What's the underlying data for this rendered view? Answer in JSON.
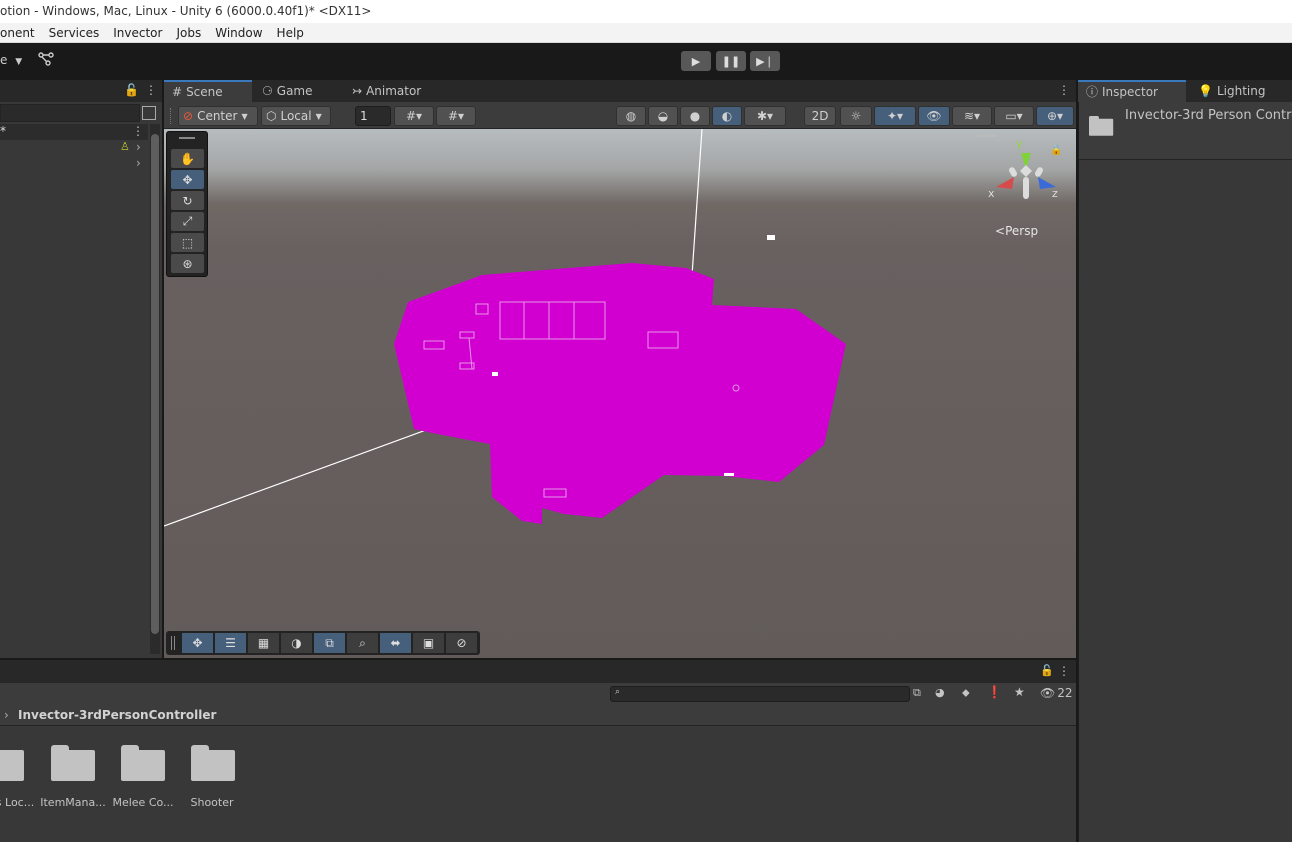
{
  "window": {
    "title": "otion - Windows, Mac, Linux - Unity 6 (6000.0.40f1)* <DX11>"
  },
  "menu": [
    "onent",
    "Services",
    "Invector",
    "Jobs",
    "Window",
    "Help"
  ],
  "toolbar": {
    "layout_fragment": "e",
    "play_icon": "play-icon",
    "pause_icon": "pause-icon",
    "step_icon": "step-icon"
  },
  "hierarchy": {
    "star": "*"
  },
  "scene_tabs": [
    {
      "label": "Scene",
      "icon": "#",
      "active": true
    },
    {
      "label": "Game",
      "icon": "gamepad-icon",
      "active": false
    },
    {
      "label": "Animator",
      "icon": "animator-icon",
      "active": false
    }
  ],
  "scene_toolbar": {
    "pivot": "Center",
    "space": "Local",
    "snap_value": "1"
  },
  "viewport": {
    "projection": "Persp",
    "gizmo_axes": {
      "x": "x",
      "y": "y",
      "z": "z"
    },
    "missing_material_color": "#d100d1"
  },
  "inspector": {
    "tabs": [
      {
        "label": "Inspector",
        "active": true
      },
      {
        "label": "Lighting",
        "active": false
      }
    ],
    "object_name": "Invector-3rd Person Contro"
  },
  "project": {
    "search_placeholder": "",
    "hidden_count": "22",
    "breadcrumb": "Invector-3rdPersonController",
    "folders": [
      "s Loc...",
      "ItemMana...",
      "Melee Co...",
      "Shooter"
    ]
  },
  "colors": {
    "accent_blue": "#46607c",
    "tab_highlight": "#3a79bb",
    "panel_bg": "#383838",
    "magenta": "#d100d1"
  }
}
